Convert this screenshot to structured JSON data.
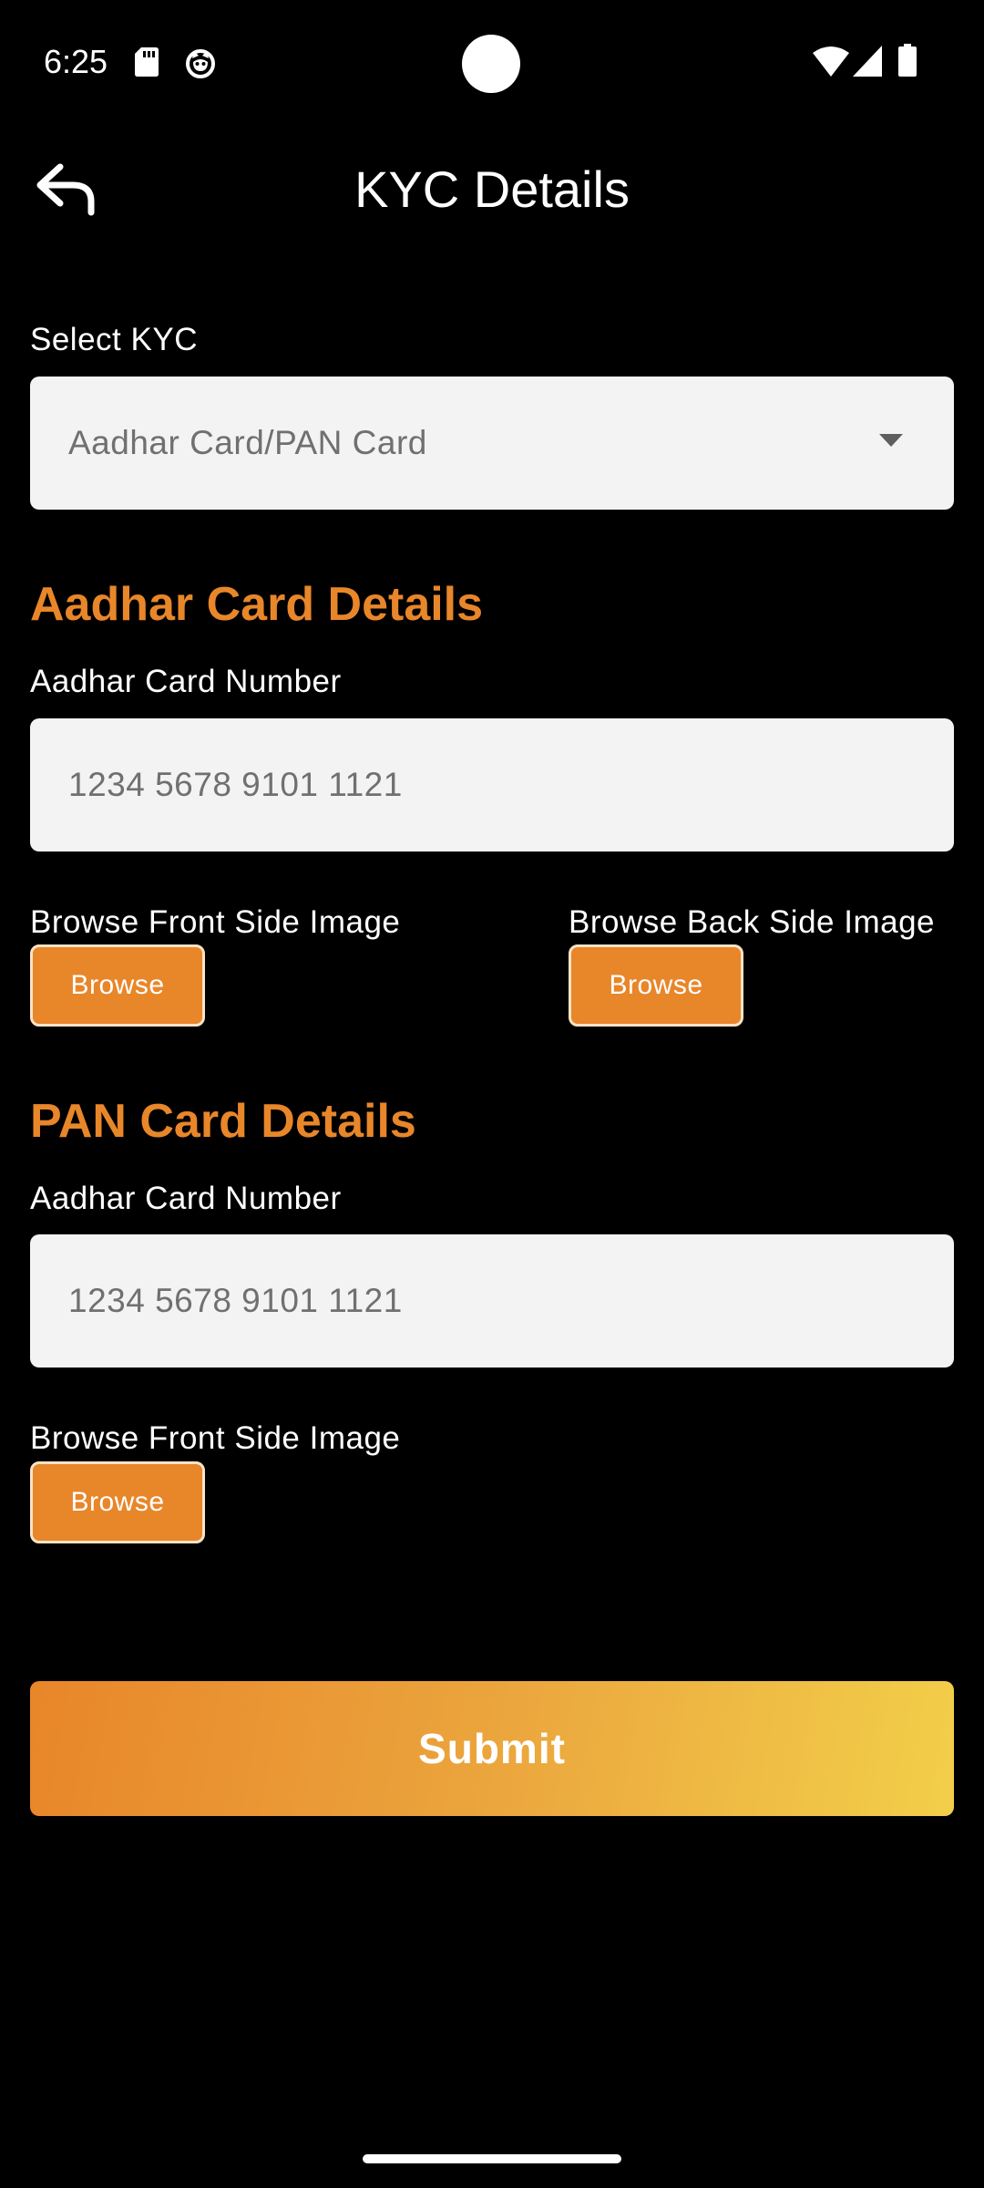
{
  "status_bar": {
    "time": "6:25",
    "icons": [
      "sd-card-icon",
      "cat-notification-icon",
      "wifi-icon",
      "signal-icon",
      "battery-icon"
    ]
  },
  "app_bar": {
    "title": "KYC Details",
    "back_icon": "back-arrow-icon"
  },
  "kyc_select": {
    "label": "Select KYC",
    "value": "Aadhar Card/PAN Card",
    "icon": "dropdown-arrow-icon"
  },
  "aadhar_section": {
    "heading": "Aadhar Card Details",
    "number_label": "Aadhar Card Number",
    "number_placeholder": "1234 5678 9101 1121",
    "front_label": "Browse Front Side Image",
    "front_button": "Browse",
    "back_label": "Browse Back Side Image",
    "back_button": "Browse"
  },
  "pan_section": {
    "heading": "PAN Card Details",
    "number_label": "Aadhar Card Number",
    "number_placeholder": "1234 5678 9101 1121",
    "front_label": "Browse Front Side Image",
    "front_button": "Browse"
  },
  "submit": {
    "label": "Submit"
  },
  "colors": {
    "background": "#000000",
    "accent": "#e8862a",
    "gradient_end": "#f2cf4a",
    "field_bg": "#f3f3f3",
    "placeholder": "#707070"
  }
}
